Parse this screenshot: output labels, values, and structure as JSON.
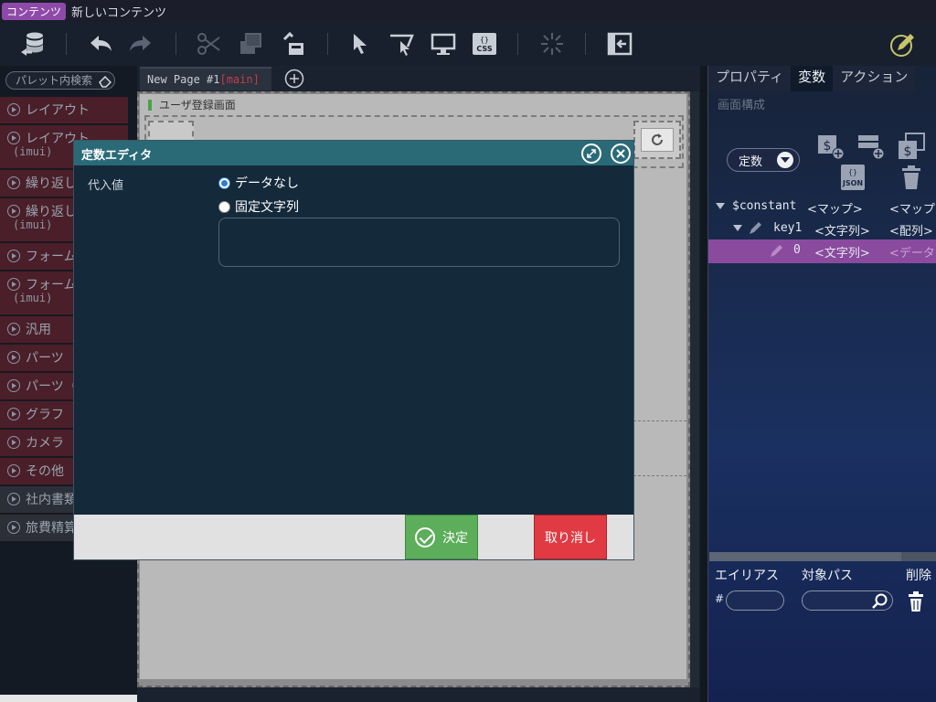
{
  "titlebar": {
    "tag": "コンテンツ",
    "title": "新しいコンテンツ"
  },
  "toolbar": {
    "icons": [
      "database-icon",
      "undo-icon",
      "redo-icon",
      "cut-icon",
      "copy-icon",
      "paste-icon",
      "pointer-icon",
      "select-icon",
      "preview-icon",
      "css-icon",
      "loading-icon",
      "exit-icon",
      "edit-icon"
    ]
  },
  "palette": {
    "search_placeholder": "パレット内検索",
    "items": [
      {
        "label": "レイアウト",
        "sub": ""
      },
      {
        "label": "レイアウト",
        "sub": "(imui)"
      },
      {
        "label": "繰り返し",
        "sub": ""
      },
      {
        "label": "繰り返し",
        "sub": "(imui)"
      },
      {
        "label": "フォーム",
        "sub": ""
      },
      {
        "label": "フォーム",
        "sub": "(imui)"
      },
      {
        "label": "汎用",
        "sub": ""
      },
      {
        "label": "パーツ",
        "sub": ""
      },
      {
        "label": "パーツ（",
        "sub": ""
      },
      {
        "label": "グラフ",
        "sub": ""
      },
      {
        "label": "カメラ",
        "sub": ""
      },
      {
        "label": "その他",
        "sub": ""
      },
      {
        "label": "社内書類",
        "sub": ""
      },
      {
        "label": "旅費精算",
        "sub": ""
      }
    ]
  },
  "page": {
    "tab_label": "New Page #1",
    "tab_tag": "[main]",
    "screen_name": "ユーザ登録画面"
  },
  "right_panel": {
    "tabs": [
      "プロパティ",
      "変数",
      "アクション"
    ],
    "active_tab": "変数",
    "subtitle": "画面構成",
    "variable_type": "定数",
    "tree": [
      {
        "name": "$constant",
        "type": "<マップ>",
        "value": "<マップ>"
      },
      {
        "name": "key1",
        "type": "<文字列>",
        "value": "<配列>"
      },
      {
        "name": "0",
        "type": "<文字列>",
        "value": "<データ"
      }
    ],
    "alias_columns": [
      "エイリアス",
      "対象パス",
      "削除"
    ],
    "alias_hash": "#"
  },
  "modal": {
    "title": "定数エディタ",
    "field_label": "代入値",
    "options": [
      "データなし",
      "固定文字列"
    ],
    "selected_option": "データなし",
    "fixed_text_value": "",
    "ok_label": "決定",
    "cancel_label": "取り消し"
  },
  "colors": {
    "accent_purple": "#8a4a9e",
    "modal_header": "#2a6a77",
    "ok_green": "#5cae5a",
    "cancel_red": "#e13a43"
  }
}
